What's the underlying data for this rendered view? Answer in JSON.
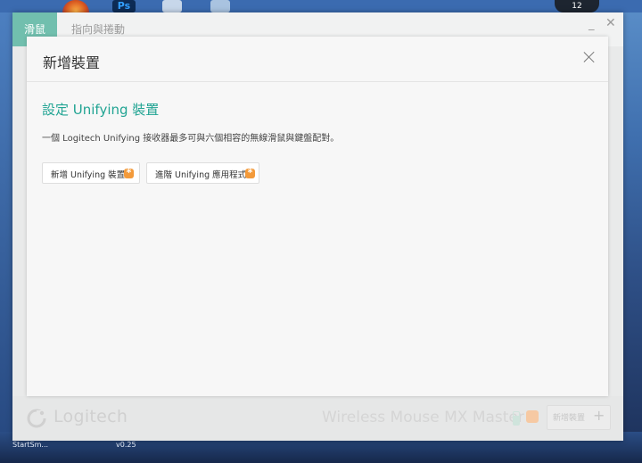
{
  "desktop": {
    "ps_icon_label": "Ps",
    "clock_text": "12",
    "taskbar_left": "StartSm...",
    "taskbar_mid": "v0.25"
  },
  "app": {
    "tabs": [
      {
        "label": "滑鼠",
        "active": true
      },
      {
        "label": "指向與捲動",
        "active": false
      }
    ],
    "minimize_glyph": "_",
    "close_glyph": "✕",
    "footer": {
      "brand": "Logitech",
      "device_name": "Wireless Mouse MX Master",
      "add_device_label": "新增裝置",
      "add_device_plus": "+"
    }
  },
  "dialog": {
    "title": "新增裝置",
    "section_title": "設定 Unifying 裝置",
    "description": "一個 Logitech Unifying 接收器最多可與六個相容的無線滑鼠與鍵盤配對。",
    "buttons": [
      {
        "label": "新增 Unifying 裝置",
        "icon": "unifying-icon"
      },
      {
        "label": "進階 Unifying 應用程式",
        "icon": "unifying-icon"
      }
    ]
  },
  "colors": {
    "accent_teal": "#21a493",
    "tab_active": "#71bfae",
    "unifying_orange": "#f39a3a"
  }
}
